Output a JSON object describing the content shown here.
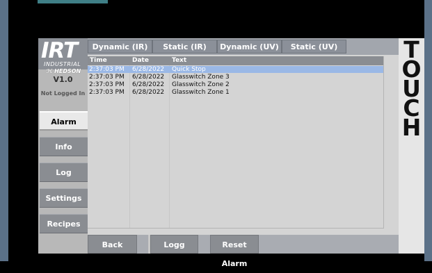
{
  "brand": {
    "side_text": "TOUCH",
    "logo": "IRT",
    "logo_sub": "INDUSTRIAL",
    "maker": "HEDSON"
  },
  "sidebar": {
    "version": "V1.0",
    "login_status": "Not Logged In",
    "items": [
      {
        "label": "Alarm",
        "active": true
      },
      {
        "label": "Info",
        "active": false
      },
      {
        "label": "Log",
        "active": false
      },
      {
        "label": "Settings",
        "active": false
      },
      {
        "label": "Recipes",
        "active": false
      }
    ]
  },
  "tabs": [
    {
      "label": "Dynamic (IR)"
    },
    {
      "label": "Static (IR)"
    },
    {
      "label": "Dynamic (UV)"
    },
    {
      "label": "Static (UV)"
    }
  ],
  "table": {
    "columns": [
      "Time",
      "Date",
      "Text"
    ],
    "rows": [
      {
        "time": "2:37:03 PM",
        "date": "6/28/2022",
        "text": "Quick Stop",
        "selected": true
      },
      {
        "time": "2:37:03 PM",
        "date": "6/28/2022",
        "text": "Glasswitch Zone 3",
        "selected": false
      },
      {
        "time": "2:37:03 PM",
        "date": "6/28/2022",
        "text": "Glasswitch Zone 2",
        "selected": false
      },
      {
        "time": "2:37:03 PM",
        "date": "6/28/2022",
        "text": "Glasswitch Zone 1",
        "selected": false
      }
    ]
  },
  "footer": {
    "back": "Back",
    "logg": "Logg",
    "reset": "Reset Alarm"
  },
  "colors": {
    "bezel": "#5b7188",
    "button": "#8a8d92",
    "selected_row": "#9ab8e6",
    "accent_tab": "#3f7f86"
  }
}
